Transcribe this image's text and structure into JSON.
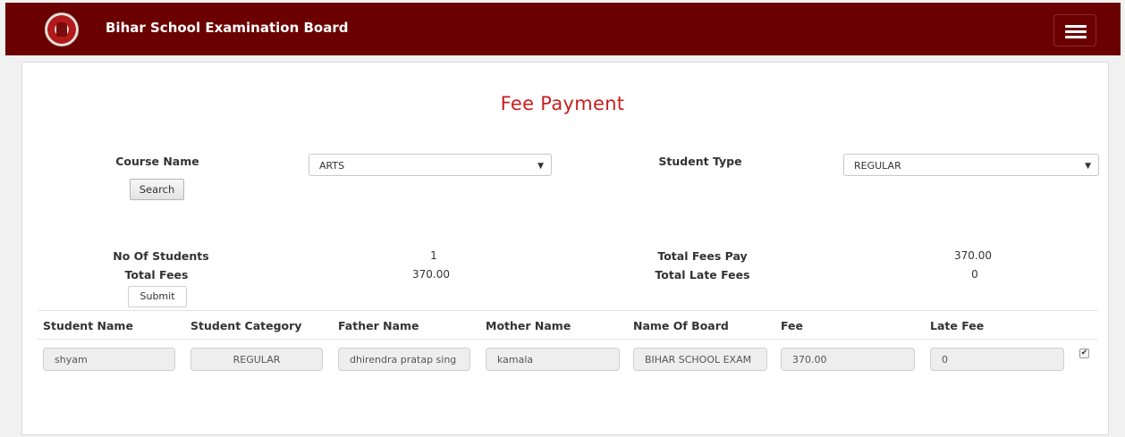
{
  "header": {
    "brand": "Bihar School Examination Board"
  },
  "page": {
    "title": "Fee Payment"
  },
  "filters": {
    "course_label": "Course Name",
    "course_value": "ARTS",
    "student_type_label": "Student Type",
    "student_type_value": "REGULAR",
    "search_label": "Search"
  },
  "summary": {
    "no_students_label": "No Of Students",
    "no_students_value": "1",
    "total_fees_pay_label": "Total Fees Pay",
    "total_fees_pay_value": "370.00",
    "total_fees_label": "Total Fees",
    "total_fees_value": "370.00",
    "total_late_fees_label": "Total Late Fees",
    "total_late_fees_value": "0",
    "submit_label": "Submit"
  },
  "table": {
    "headers": [
      "Student Name",
      "Student Category",
      "Father Name",
      "Mother Name",
      "Name Of Board",
      "Fee",
      "Late Fee"
    ],
    "row": {
      "student_name": "shyam",
      "category": "REGULAR",
      "father_name": "dhirendra pratap sing",
      "mother_name": "kamala",
      "board": "BIHAR SCHOOL EXAM",
      "fee": "370.00",
      "late_fee": "0",
      "checked": true
    }
  },
  "colors": {
    "header_bg": "#6b0000",
    "title": "#c81e1e"
  }
}
